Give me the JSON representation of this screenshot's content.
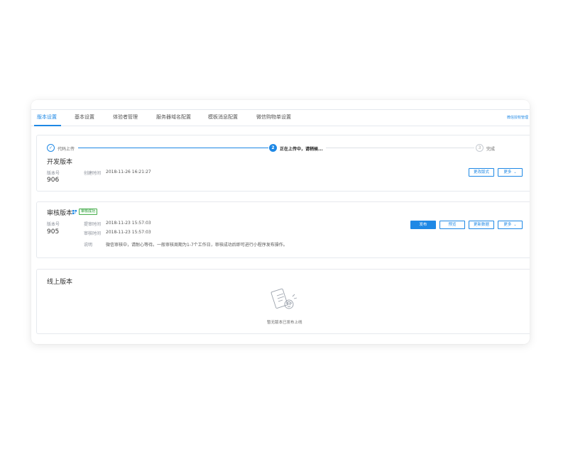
{
  "tabs": {
    "items": [
      "版本设置",
      "基本设置",
      "体验者管理",
      "服务器域名配置",
      "模板消息配置",
      "微信购物单设置"
    ],
    "active_index": 0,
    "right_link": "微信授权管理"
  },
  "dev": {
    "steps": [
      {
        "label": "代码上传",
        "state": "done",
        "mark": "✓"
      },
      {
        "label": "正在上传中，请稍候...",
        "state": "current",
        "mark": "2"
      },
      {
        "label": "完成",
        "state": "todo",
        "mark": "3"
      }
    ],
    "title": "开发版本",
    "version_label": "版本号",
    "version": "906",
    "created_label": "创建时间",
    "created_value": "2018-11-26 16:21:27",
    "btn_change": "更改版式",
    "btn_more": "更多"
  },
  "review": {
    "title": "审核版本",
    "status_badge": "审核成功",
    "version_label": "版本号",
    "version": "905",
    "submit_label": "提审时间",
    "submit_value": "2018-11-23 15:57:03",
    "audit_label": "审核时间",
    "audit_value": "2018-11-23 15:57:03",
    "note_label": "说明",
    "note_value": "微信审核中，请耐心等待。一般审核周期为1-7个工作日，审核成功后即可进行小程序发布操作。",
    "btn_publish": "发布",
    "btn_preview": "预览",
    "btn_update": "更新数据",
    "btn_more": "更多"
  },
  "online": {
    "title": "线上版本",
    "empty_text": "暂无版本已发布上线"
  },
  "colors": {
    "accent": "#1e88e5",
    "success": "#4caf50"
  }
}
